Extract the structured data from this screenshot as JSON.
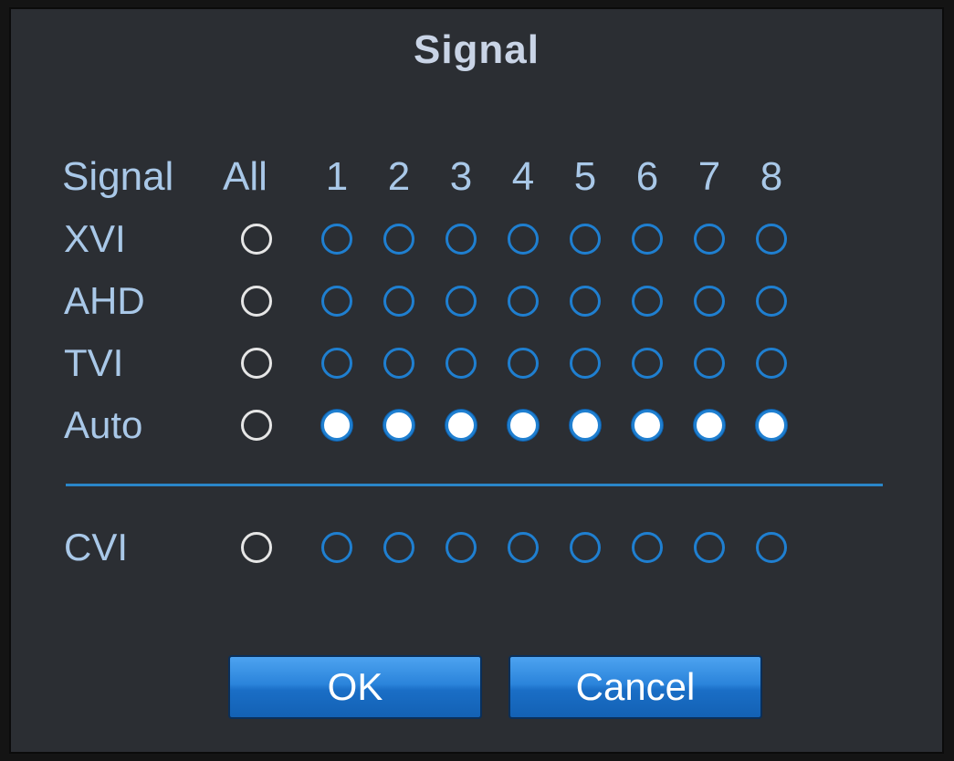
{
  "dialog": {
    "title": "Signal"
  },
  "header": {
    "signal_label": "Signal",
    "all_label": "All",
    "channels": [
      "1",
      "2",
      "3",
      "4",
      "5",
      "6",
      "7",
      "8"
    ]
  },
  "rows": [
    {
      "label": "XVI",
      "all_selected": false,
      "channels": [
        false,
        false,
        false,
        false,
        false,
        false,
        false,
        false
      ]
    },
    {
      "label": "AHD",
      "all_selected": false,
      "channels": [
        false,
        false,
        false,
        false,
        false,
        false,
        false,
        false
      ]
    },
    {
      "label": "TVI",
      "all_selected": false,
      "channels": [
        false,
        false,
        false,
        false,
        false,
        false,
        false,
        false
      ]
    },
    {
      "label": "Auto",
      "all_selected": false,
      "channels": [
        true,
        true,
        true,
        true,
        true,
        true,
        true,
        true
      ]
    },
    {
      "label": "CVI",
      "all_selected": false,
      "channels": [
        false,
        false,
        false,
        false,
        false,
        false,
        false,
        false
      ]
    }
  ],
  "buttons": {
    "ok_label": "OK",
    "cancel_label": "Cancel"
  },
  "colors": {
    "background": "#2b2e33",
    "text": "#a9c8e8",
    "title": "#c9d4e6",
    "accent": "#1f7fd0",
    "button": "#2b84db"
  }
}
